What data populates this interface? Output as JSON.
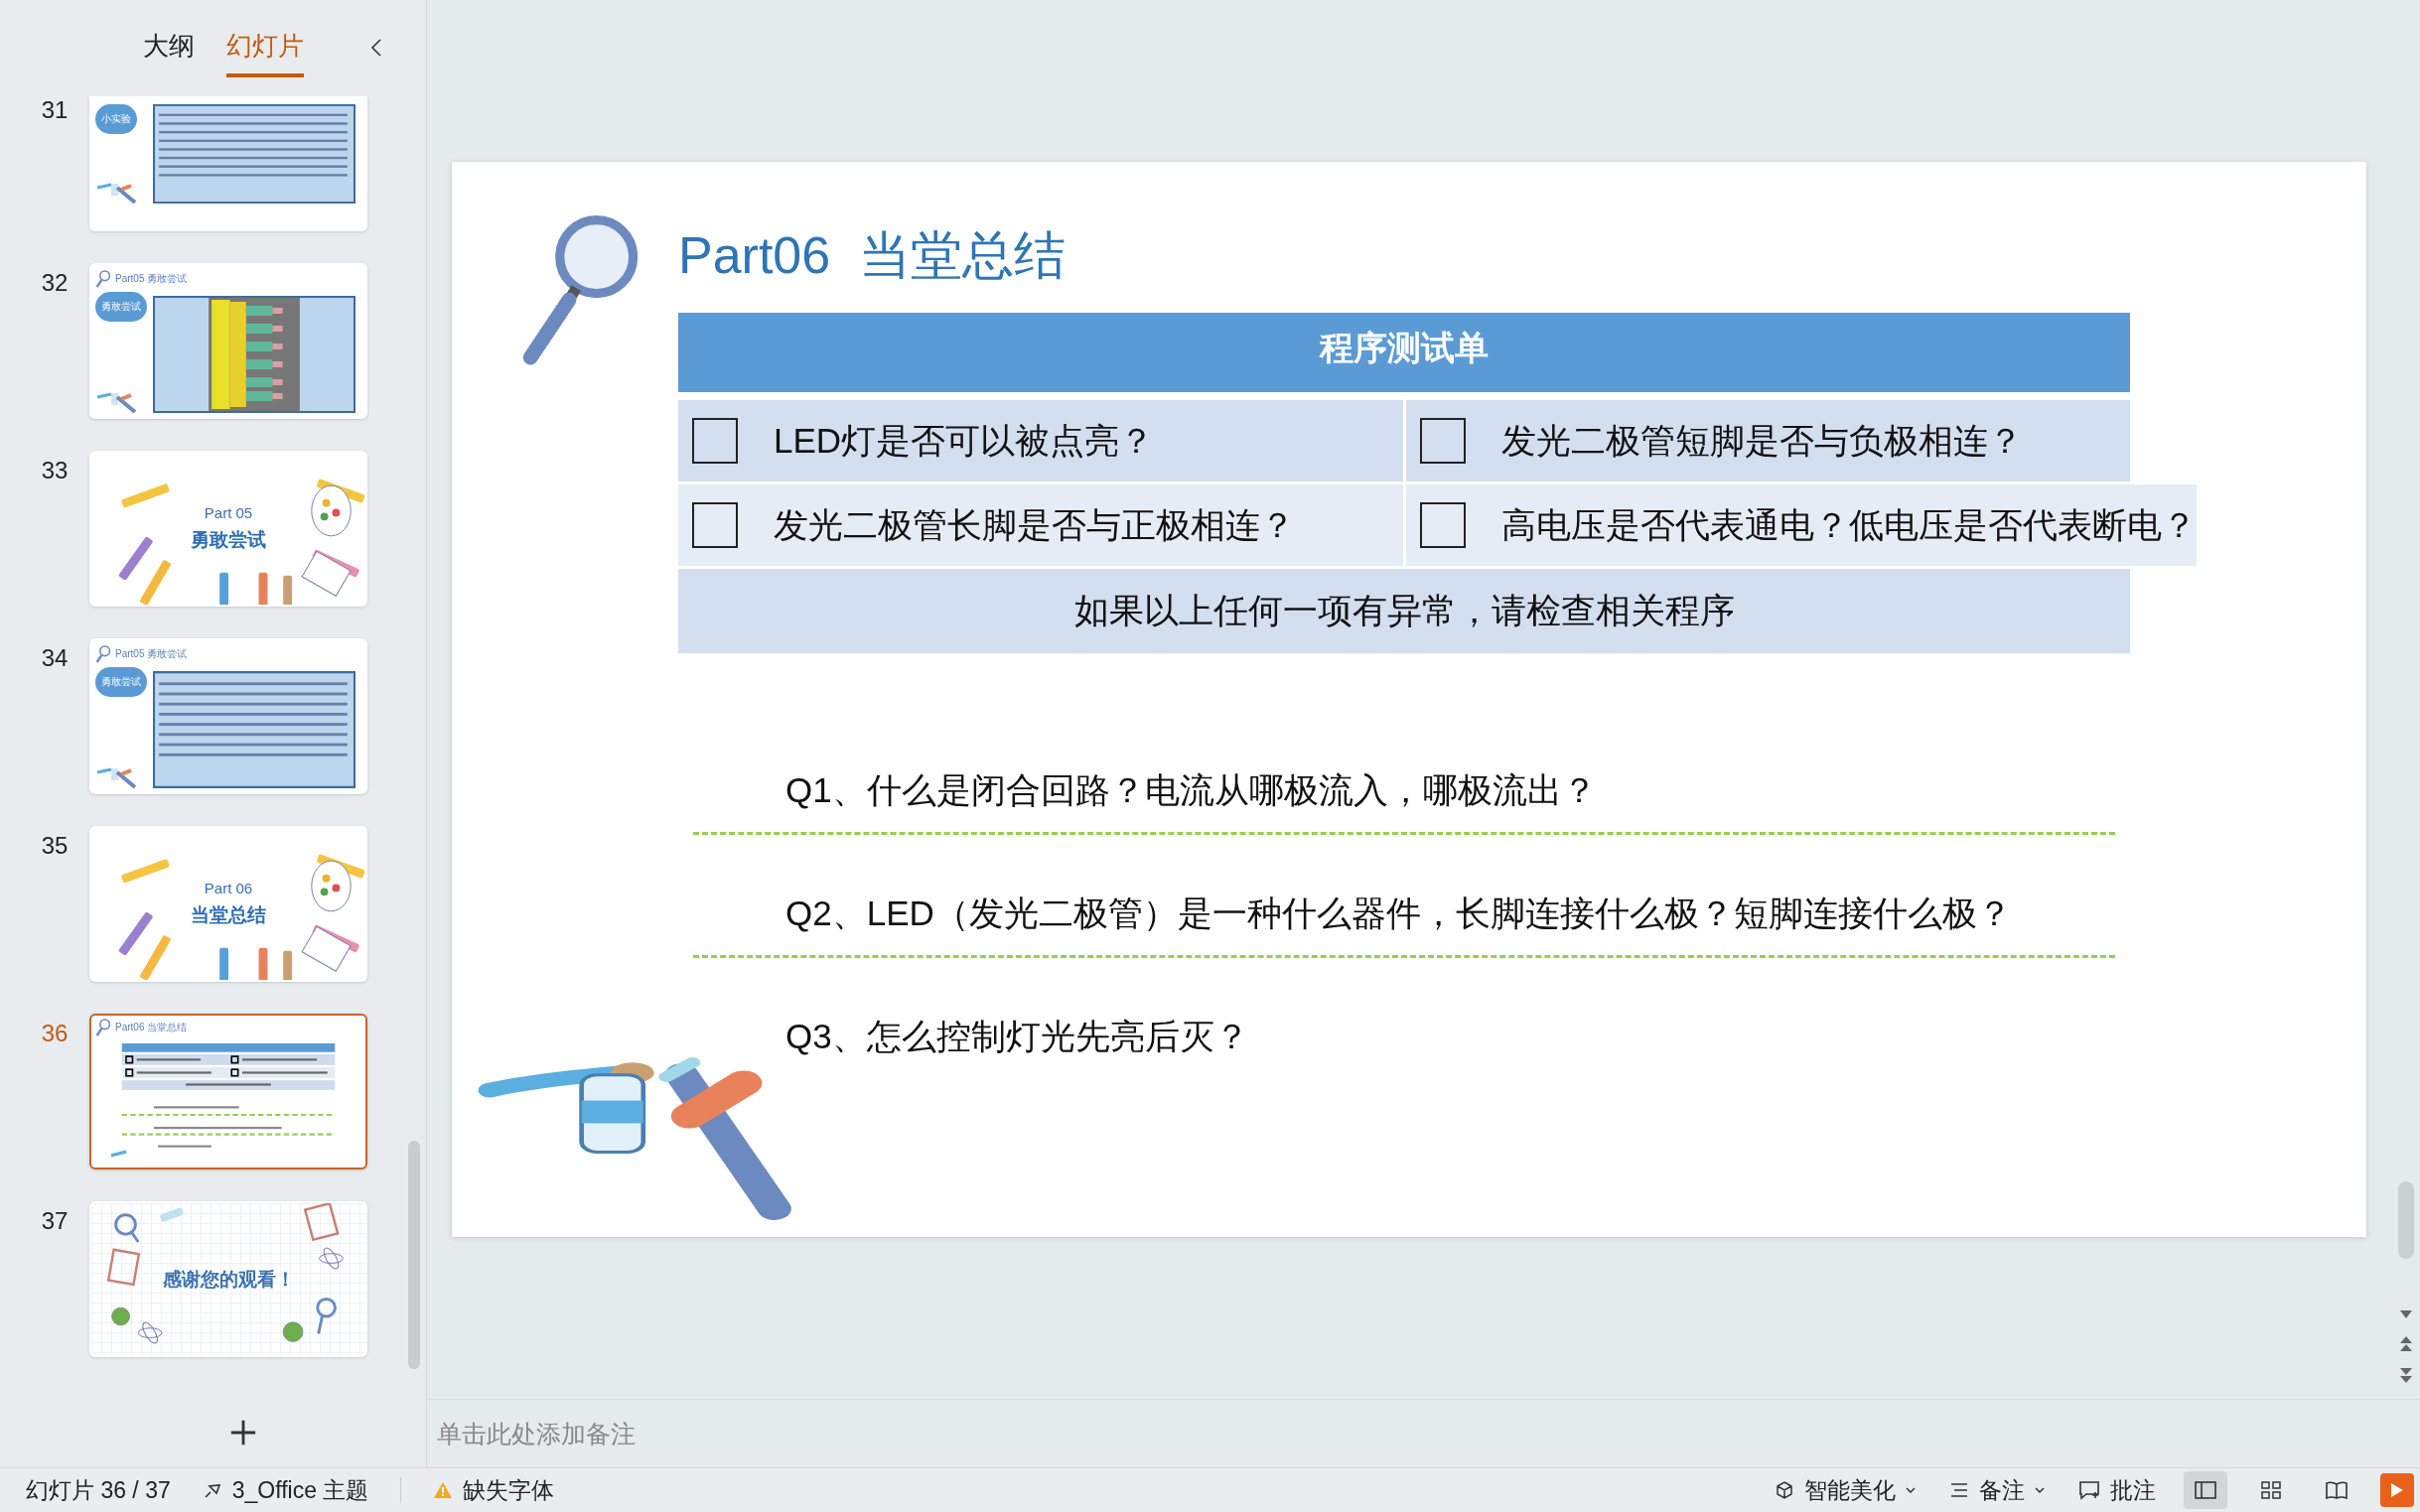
{
  "panel_tabs": [
    {
      "label": "大纲",
      "selected": false
    },
    {
      "label": "幻灯片",
      "selected": true
    }
  ],
  "thumbnails": [
    {
      "number": "31",
      "kind": "panel",
      "cloud": "小实验",
      "selected": false,
      "cut": true
    },
    {
      "number": "32",
      "kind": "code",
      "header": "Part05  勇敢尝试",
      "cloud": "勇敢尝试",
      "selected": false
    },
    {
      "number": "33",
      "kind": "cover",
      "part": "Part 05",
      "title": "勇敢尝试",
      "selected": false
    },
    {
      "number": "34",
      "kind": "panel",
      "header": "Part05  勇敢尝试",
      "cloud": "勇敢尝试",
      "selected": false
    },
    {
      "number": "35",
      "kind": "cover",
      "part": "Part 06",
      "title": "当堂总结",
      "selected": false
    },
    {
      "number": "36",
      "kind": "summary",
      "header": "Part06  当堂总结",
      "selected": true
    },
    {
      "number": "37",
      "kind": "thanks",
      "title": "感谢您的观看！",
      "selected": false
    }
  ],
  "slide": {
    "title": "Part06  当堂总结",
    "table": {
      "header": "程序测试单",
      "rows": [
        [
          {
            "text": "LED灯是否可以被点亮？",
            "checked": false
          },
          {
            "text": "发光二极管短脚是否与负极相连？",
            "checked": false
          }
        ],
        [
          {
            "text": "发光二极管长脚是否与正极相连？",
            "checked": false
          },
          {
            "text": "高电压是否代表通电？低电压是否代表断电？",
            "checked": false
          }
        ]
      ],
      "footer": "如果以上任何一项有异常，请检查相关程序"
    },
    "questions": [
      {
        "text": "Q1、什么是闭合回路？电流从哪极流入，哪极流出？",
        "underlined": true
      },
      {
        "text": "Q2、LED（发光二极管）是一种什么器件，长脚连接什么极？短脚连接什么极？",
        "underlined": true
      },
      {
        "text": "Q3、怎么控制灯光先亮后灭？",
        "underlined": false
      }
    ]
  },
  "notes": {
    "placeholder": "单击此处添加备注"
  },
  "status_bar": {
    "slide_counter": "幻灯片 36 / 37",
    "theme": "3_Office 主题",
    "missing_fonts": "缺失字体",
    "beautify": "智能美化",
    "notes": "备注",
    "comments": "批注",
    "views": [
      {
        "kind": "normal",
        "selected": true
      },
      {
        "kind": "sorter",
        "selected": false
      },
      {
        "kind": "reading",
        "selected": false
      }
    ]
  }
}
